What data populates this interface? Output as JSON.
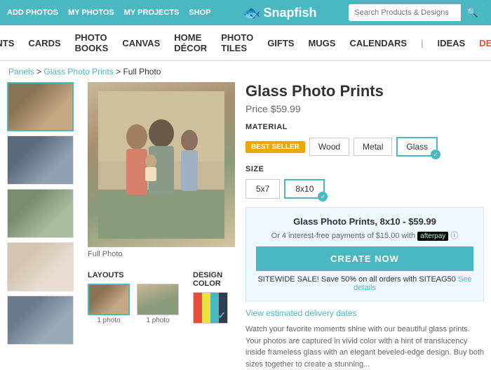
{
  "topbar": {
    "nav_items": [
      "ADD PHOTOS",
      "MY PHOTOS",
      "MY PROJECTS",
      "SHOP"
    ],
    "logo": "Snapfish",
    "search_placeholder": "Search Products & Designs"
  },
  "mainnav": {
    "items": [
      "PRINTS",
      "CARDS",
      "PHOTO BOOKS",
      "CANVAS",
      "HOME DÉCOR",
      "PHOTO TILES",
      "GIFTS",
      "MUGS",
      "CALENDARS",
      "IDEAS",
      "DEALS"
    ]
  },
  "breadcrumb": {
    "parts": [
      "Panels",
      "Glass Photo Prints",
      "Full Photo"
    ]
  },
  "product": {
    "title": "Glass Photo Prints",
    "price": "Price $59.99",
    "material_label": "MATERIAL",
    "best_seller": "BEST SELLER",
    "materials": [
      "Wood",
      "Metal",
      "Glass"
    ],
    "selected_material": "Glass",
    "size_label": "SIZE",
    "sizes": [
      "5x7",
      "8x10"
    ],
    "selected_size": "8x10",
    "price_box_title": "Glass Photo Prints, 8x10 - $59.99",
    "afterpay_line": "Or 4 interest-free payments of $15.00 with",
    "afterpay_logo": "afterpay",
    "create_btn": "CREATE NOW",
    "sitewide_label": "SITEWIDE SALE!",
    "sitewide_text": " Save 50% on all orders with SITEAG50",
    "see_details": "See details",
    "delivery_link": "View estimated delivery dates",
    "description": "Watch your favorite moments shine with our beautiful glass prints. Your photos are captured in vivid color with a hint of translucency inside frameless glass with an elegant beveled-edge design. Buy both sizes together to create a stunning..."
  },
  "thumbnails": {
    "label": "Full Photo",
    "thumb5_label": ""
  },
  "layouts": {
    "title": "LAYOUTS",
    "options": [
      {
        "count": "1 photo"
      },
      {
        "count": "1 photo"
      }
    ]
  },
  "design_color": {
    "title": "DESIGN COLOR",
    "colors": [
      "#e74c3c",
      "#f0e040",
      "#4ab8c1",
      "#2c3e50"
    ]
  }
}
